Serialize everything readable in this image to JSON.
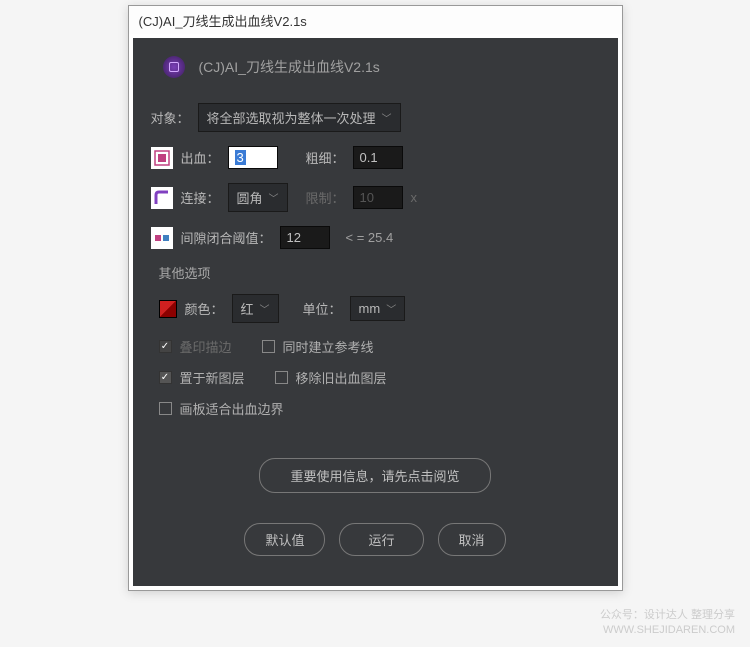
{
  "window": {
    "title": "(CJ)AI_刀线生成出血线V2.1s"
  },
  "header": {
    "title": "(CJ)AI_刀线生成出血线V2.1s"
  },
  "target": {
    "label": "对象：",
    "value": "将全部选取视为整体一次处理"
  },
  "bleed": {
    "label": "出血：",
    "value": "3",
    "thickness_label": "粗细：",
    "thickness_value": "0.1"
  },
  "join": {
    "label": "连接：",
    "value": "圆角",
    "limit_label": "限制：",
    "limit_value": "10",
    "limit_unit": "x"
  },
  "gap": {
    "label": "间隙闭合阈值：",
    "value": "12",
    "hint": "< = 25.4"
  },
  "other": {
    "title": "其他选项",
    "color_label": "颜色：",
    "color_value": "红",
    "unit_label": "单位：",
    "unit_value": "mm",
    "overprint_label": "叠印描边",
    "guide_label": "同时建立参考线",
    "newlayer_label": "置于新图层",
    "remove_label": "移除旧出血图层",
    "artboard_label": "画板适合出血边界"
  },
  "info_button": "重要使用信息，请先点击阅览",
  "buttons": {
    "default": "默认值",
    "run": "运行",
    "cancel": "取消"
  },
  "watermark": {
    "line1": "公众号：设计达人 整理分享",
    "line2": "WWW.SHEJIDAREN.COM"
  }
}
